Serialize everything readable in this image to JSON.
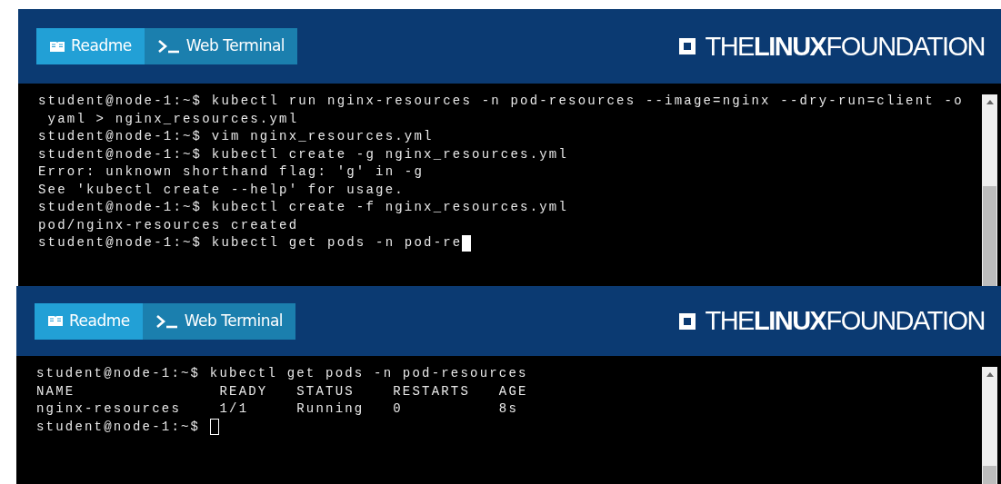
{
  "panels": [
    {
      "tabs": [
        {
          "label": "Readme",
          "kind": "book",
          "selected": false
        },
        {
          "label": "Web Terminal",
          "kind": "prompt",
          "selected": true
        }
      ],
      "logo": "THE**LINUX**FOUNDATION",
      "terminal": {
        "lines": [
          "student@node-1:~$ kubectl run nginx-resources -n pod-resources --image=nginx --dry-run=client -o",
          " yaml > nginx_resources.yml",
          "student@node-1:~$ vim nginx_resources.yml",
          "student@node-1:~$ kubectl create -g nginx_resources.yml",
          "Error: unknown shorthand flag: 'g' in -g",
          "See 'kubectl create --help' for usage.",
          "student@node-1:~$ kubectl create -f nginx_resources.yml",
          "pod/nginx-resources created",
          "student@node-1:~$ kubectl get pods -n pod-re"
        ],
        "cursor_focused": true
      }
    },
    {
      "tabs": [
        {
          "label": "Readme",
          "kind": "book",
          "selected": false
        },
        {
          "label": "Web Terminal",
          "kind": "prompt",
          "selected": true
        }
      ],
      "logo": "THE**LINUX**FOUNDATION",
      "terminal": {
        "lines": [
          "student@node-1:~$ kubectl get pods -n pod-resources",
          "NAME               READY   STATUS    RESTARTS   AGE",
          "nginx-resources    1/1     Running   0          8s",
          "student@node-1:~$ "
        ],
        "cursor_focused": false
      }
    }
  ]
}
